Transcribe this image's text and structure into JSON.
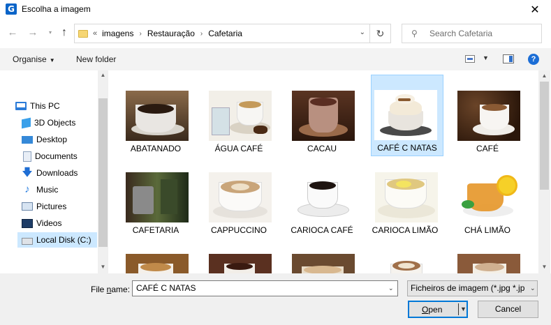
{
  "window": {
    "title": "Escolha a imagem",
    "app_icon_letter": "G",
    "close_glyph": "✕"
  },
  "nav": {
    "back_glyph": "←",
    "forward_glyph": "→",
    "recent_glyph": "▾",
    "up_glyph": "↑",
    "breadcrumb_prefix": "«",
    "breadcrumb": [
      "imagens",
      "Restauração",
      "Cafetaria"
    ],
    "breadcrumb_sep": "›",
    "refresh_glyph": "↻",
    "search": {
      "placeholder": "Search Cafetaria",
      "icon": "search-icon"
    }
  },
  "commands": {
    "organise_label": "Organise",
    "new_folder_label": "New folder",
    "help_glyph": "?"
  },
  "sidebar": {
    "items": [
      {
        "label": "This PC",
        "icon": "pc-icon"
      },
      {
        "label": "3D Objects",
        "icon": "cube-icon"
      },
      {
        "label": "Desktop",
        "icon": "desktop-icon"
      },
      {
        "label": "Documents",
        "icon": "document-icon"
      },
      {
        "label": "Downloads",
        "icon": "download-icon"
      },
      {
        "label": "Music",
        "icon": "music-icon"
      },
      {
        "label": "Pictures",
        "icon": "pictures-icon"
      },
      {
        "label": "Videos",
        "icon": "video-icon"
      },
      {
        "label": "Local Disk (C:)",
        "icon": "disk-icon",
        "selected": true
      }
    ]
  },
  "files": [
    {
      "name": "ABATANADO"
    },
    {
      "name": "ÁGUA CAFÉ"
    },
    {
      "name": "CACAU"
    },
    {
      "name": "CAFÉ C NATAS",
      "selected": true
    },
    {
      "name": "CAFÉ"
    },
    {
      "name": "CAFETARIA"
    },
    {
      "name": "CAPPUCCINO"
    },
    {
      "name": "CARIOCA CAFÉ"
    },
    {
      "name": "CARIOCA LIMÃO"
    },
    {
      "name": "CHÁ LIMÃO"
    }
  ],
  "footer": {
    "filename_label_prefix": "File ",
    "filename_label_underlined": "n",
    "filename_label_suffix": "ame:",
    "filename_value": "CAFÉ C NATAS",
    "filetype_value": "Ficheiros de imagem (*.jpg *.jp",
    "open_label_underlined": "O",
    "open_label_rest": "pen",
    "cancel_label": "Cancel"
  },
  "colors": {
    "accent": "#0078d7",
    "selection": "#cce8ff",
    "help_blue": "#1c6ed6"
  }
}
